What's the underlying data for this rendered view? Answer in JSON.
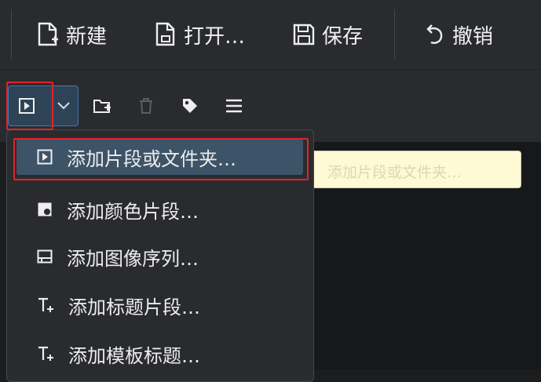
{
  "toolbar": {
    "new_label": "新建",
    "open_label": "打开…",
    "save_label": "保存",
    "undo_label": "撤销"
  },
  "bin_toolbar": {
    "icons": [
      "add-clip-icon",
      "dropdown-chevron-icon",
      "add-folder-icon",
      "delete-icon",
      "tag-icon",
      "hamburger-menu-icon"
    ]
  },
  "menu": {
    "items": [
      {
        "label": "添加片段或文件夹…",
        "icon": "add-clip-icon",
        "active": true
      },
      {
        "label": "添加颜色片段…",
        "icon": "color-clip-icon"
      },
      {
        "label": "添加图像序列…",
        "icon": "image-sequence-icon"
      },
      {
        "label": "添加标题片段…",
        "icon": "title-clip-icon"
      },
      {
        "label": "添加模板标题…",
        "icon": "template-title-icon"
      }
    ]
  },
  "colors": {
    "accent": "#3d5367",
    "highlight": "#e0242b",
    "tooltip_bg": "#fdfad4"
  }
}
